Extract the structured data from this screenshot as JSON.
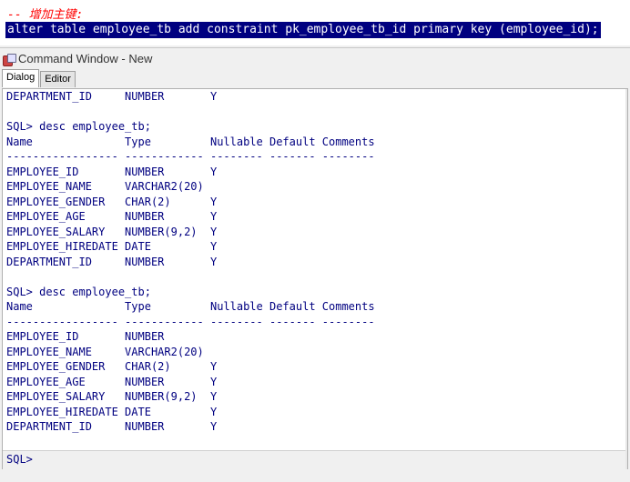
{
  "editor": {
    "comment": "-- 增加主键:",
    "selected_sql": "alter table employee_tb add constraint pk_employee_tb_id primary key (employee_id);"
  },
  "window": {
    "title": "Command Window - New",
    "tabs": [
      {
        "label": "Dialog",
        "active": true
      },
      {
        "label": "Editor",
        "active": false
      }
    ]
  },
  "console": {
    "lines": [
      "DEPARTMENT_ID     NUMBER       Y",
      "",
      "SQL> desc employee_tb;",
      "Name              Type         Nullable Default Comments",
      "----------------- ------------ -------- ------- --------",
      "EMPLOYEE_ID       NUMBER       Y",
      "EMPLOYEE_NAME     VARCHAR2(20)",
      "EMPLOYEE_GENDER   CHAR(2)      Y",
      "EMPLOYEE_AGE      NUMBER       Y",
      "EMPLOYEE_SALARY   NUMBER(9,2)  Y",
      "EMPLOYEE_HIREDATE DATE         Y",
      "DEPARTMENT_ID     NUMBER       Y",
      "",
      "SQL> desc employee_tb;",
      "Name              Type         Nullable Default Comments",
      "----------------- ------------ -------- ------- --------",
      "EMPLOYEE_ID       NUMBER",
      "EMPLOYEE_NAME     VARCHAR2(20)",
      "EMPLOYEE_GENDER   CHAR(2)      Y",
      "EMPLOYEE_AGE      NUMBER       Y",
      "EMPLOYEE_SALARY   NUMBER(9,2)  Y",
      "EMPLOYEE_HIREDATE DATE         Y",
      "DEPARTMENT_ID     NUMBER       Y"
    ],
    "prompt": "SQL>"
  },
  "colors": {
    "console_text": "#000080",
    "selection_bg": "#000080",
    "comment": "#ff0000"
  }
}
